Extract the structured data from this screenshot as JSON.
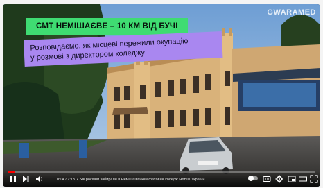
{
  "video": {
    "watermark": "GWARAMED",
    "title_banner": "СМТ НЕМІШАЄВЕ – 10 КМ ВІД БУЧІ",
    "subtitle_lines": [
      "Розповідаємо, як місцеві пережили окупацію",
      "у розмові з директором коледжу"
    ],
    "colors": {
      "title_bg": "#3fdc72",
      "subtitle_bg": "#a987f0",
      "progress": "#ff0000"
    }
  },
  "player": {
    "progress_fraction": 0.02,
    "time_current": "0:04 / 7:13",
    "chapter_title": "Як росіяни забирали в Немішаївський фаховий коледж НУБіП України",
    "icons": {
      "play_pause": "pause-icon",
      "next": "next-icon",
      "volume": "volume-icon",
      "autoplay": "autoplay-toggle-icon",
      "subtitles": "subtitles-icon",
      "settings": "gear-icon",
      "miniplayer": "miniplayer-icon",
      "theater": "theater-icon",
      "fullscreen": "fullscreen-icon"
    }
  }
}
